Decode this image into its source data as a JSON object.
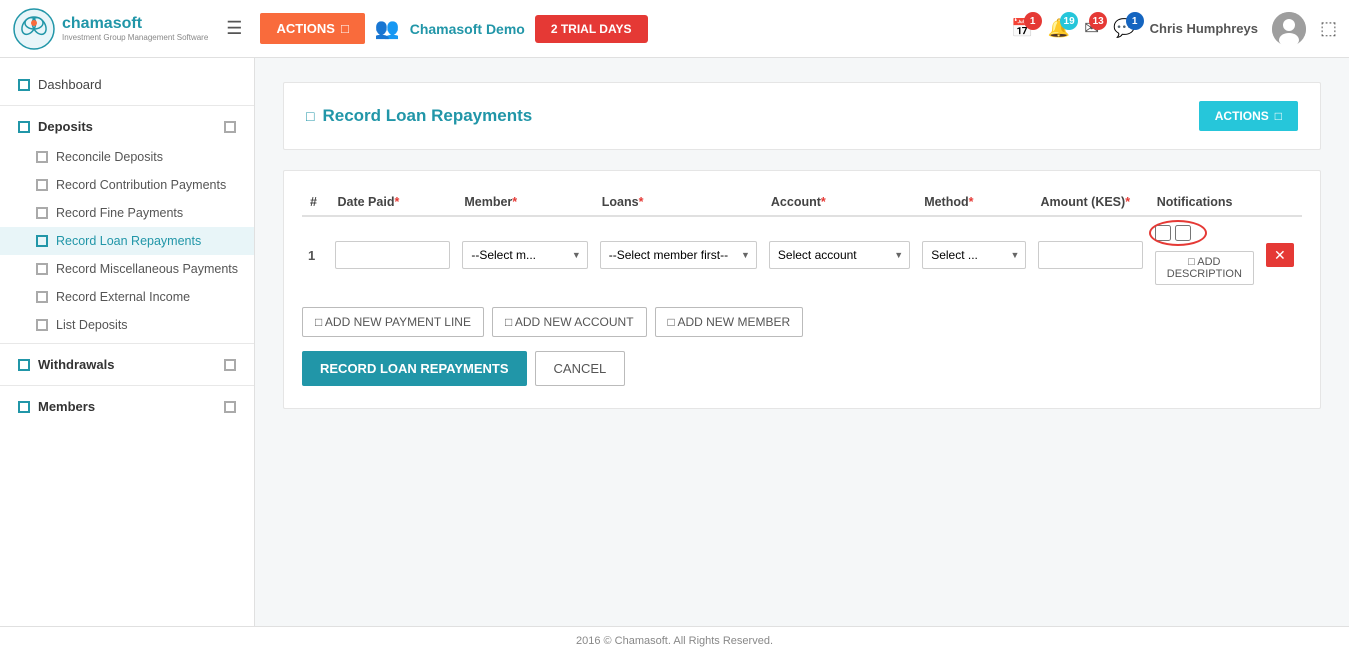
{
  "topnav": {
    "logo_name": "chamasoft",
    "logo_tagline": "Investment Group Management Software",
    "hamburger_label": "☰",
    "actions_label": "ACTIONS",
    "demo_label": "Chamasoft Demo",
    "trial_badge": "2 TRIAL DAYS",
    "badge_calendar": "1",
    "badge_notification": "19",
    "badge_message": "13",
    "badge_bell": "1",
    "user_name": "Chris Humphreys",
    "actions_icon": "□"
  },
  "sidebar": {
    "dashboard_label": "Dashboard",
    "deposits_label": "Deposits",
    "reconcile_deposits": "Reconcile Deposits",
    "record_contribution": "Record Contribution Payments",
    "record_fine": "Record Fine Payments",
    "record_loan_repayments": "Record Loan Repayments",
    "record_misc": "Record Miscellaneous Payments",
    "record_external": "Record External Income",
    "list_deposits": "List Deposits",
    "withdrawals_label": "Withdrawals",
    "members_label": "Members"
  },
  "page": {
    "title": "Record Loan Repayments",
    "title_icon": "□",
    "actions_btn": "ACTIONS"
  },
  "table": {
    "col_hash": "#",
    "col_date": "Date Paid",
    "col_member": "Member",
    "col_loans": "Loans",
    "col_account": "Account",
    "col_method": "Method",
    "col_amount": "Amount (KES)",
    "col_notifications": "Notifications",
    "required_star": "*",
    "row_num": "1",
    "date_placeholder": "",
    "member_select": "--Select m...",
    "member_options": [
      "--Select m..."
    ],
    "loans_select": "--Select member first--",
    "loans_options": [
      "--Select member first--"
    ],
    "account_select": "Select account",
    "account_options": [
      "Select account"
    ],
    "method_select": "Select ...",
    "method_options": [
      "Select ..."
    ],
    "amount_placeholder": "",
    "add_desc_label": "□ ADD DESCRIPTION"
  },
  "buttons": {
    "add_payment_line": "□ ADD NEW PAYMENT LINE",
    "add_account": "□ ADD NEW ACCOUNT",
    "add_member": "□ ADD NEW MEMBER",
    "record_btn": "RECORD LOAN REPAYMENTS",
    "cancel_btn": "CANCEL"
  },
  "footer": {
    "text": "2016 © Chamasoft. All Rights Reserved."
  }
}
